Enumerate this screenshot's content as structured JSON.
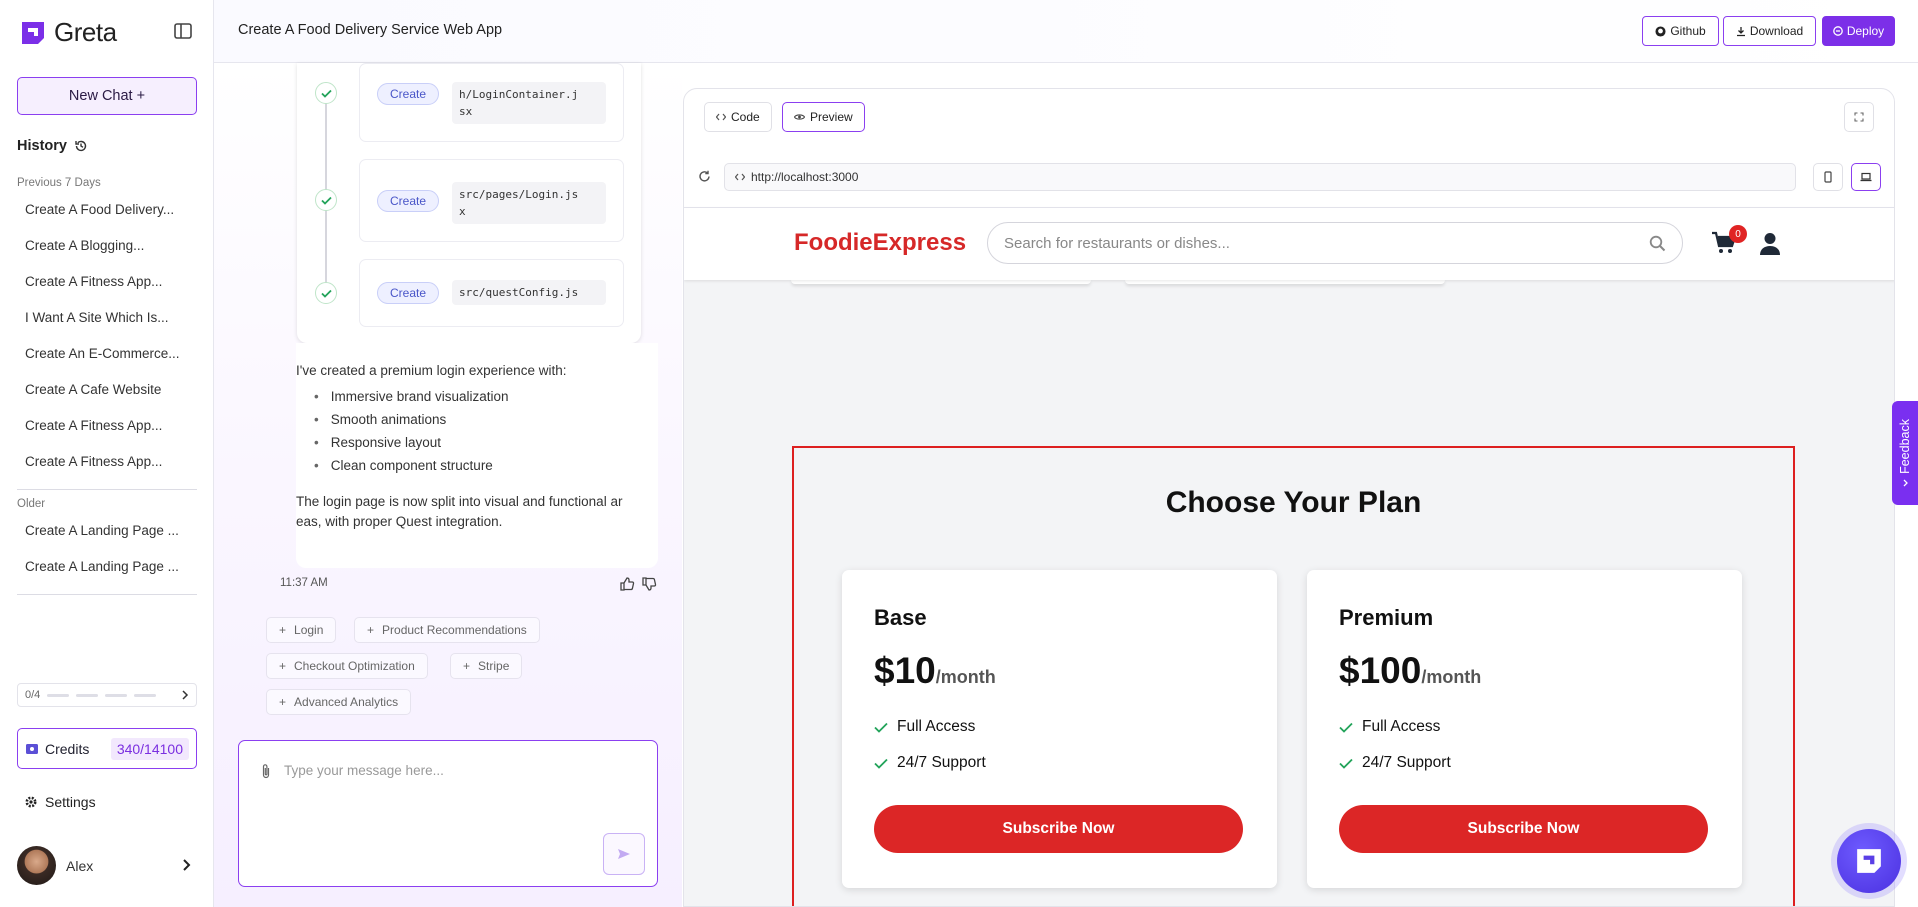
{
  "colors": {
    "accent": "#8b3ff0",
    "deploy": "#7c2fe8",
    "brand_red": "#d62828",
    "button_red": "#dc2626",
    "check_green": "#22a35a"
  },
  "sidebar": {
    "app_name": "Greta",
    "new_chat": "New Chat +",
    "history_title": "History",
    "group_recent": "Previous 7 Days",
    "recent_items": [
      "Create A Food Delivery...",
      "Create A Blogging...",
      "Create A Fitness App...",
      "I Want A Site Which Is...",
      "Create An E-Commerce...",
      "Create A Cafe Website",
      "Create A Fitness App...",
      "Create A Fitness App..."
    ],
    "group_older": "Older",
    "older_items": [
      "Create A Landing Page ...",
      "Create A Landing Page ..."
    ],
    "progress_label": "0/4",
    "credits_label": "Credits",
    "credits_value": "340/14100",
    "settings_label": "Settings",
    "user_name": "Alex"
  },
  "topbar": {
    "title": "Create A Food Delivery Service Web App",
    "github": "Github",
    "download": "Download",
    "deploy": "Deploy"
  },
  "chat": {
    "steps": [
      {
        "action": "Create",
        "file": "h/LoginContainer.j\nsx"
      },
      {
        "action": "Create",
        "file": "src/pages/Login.js\nx"
      },
      {
        "action": "Create",
        "file": "src/questConfig.js"
      }
    ],
    "intro": "I've created a premium login experience with:",
    "bullets": [
      "Immersive brand visualization",
      "Smooth animations",
      "Responsive layout",
      "Clean component structure"
    ],
    "summary": "The login page is now split into visual and functional ar\neas, with proper Quest integration.",
    "time": "11:37 AM",
    "suggestions": [
      "Login",
      "Product Recommendations",
      "Checkout Optimization",
      "Stripe",
      "Advanced Analytics"
    ],
    "input_placeholder": "Type your message here..."
  },
  "preview": {
    "code_tab": "Code",
    "preview_tab": "Preview",
    "url": "http://localhost:3000",
    "site": {
      "brand": "FoodieExpress",
      "search_placeholder": "Search for restaurants or dishes...",
      "cart_count": "0",
      "plans_title": "Choose Your Plan",
      "plans": [
        {
          "name": "Base",
          "price": "$10",
          "period": "/month",
          "features": [
            "Full Access",
            "24/7 Support"
          ],
          "cta": "Subscribe Now"
        },
        {
          "name": "Premium",
          "price": "$100",
          "period": "/month",
          "features": [
            "Full Access",
            "24/7 Support"
          ],
          "cta": "Subscribe Now"
        }
      ]
    }
  },
  "feedback_tab": "Feedback",
  "icons": [
    "logo-icon",
    "sidebar-toggle-icon",
    "history-icon",
    "chevron-right-icon",
    "ticket-icon",
    "gear-icon",
    "github-icon",
    "download-icon",
    "deploy-icon",
    "check-icon",
    "thumbs-up-icon",
    "thumbs-down-icon",
    "plus-icon",
    "paperclip-icon",
    "send-icon",
    "code-icon",
    "eye-icon",
    "expand-icon",
    "refresh-icon",
    "phone-icon",
    "laptop-icon",
    "search-icon",
    "cart-icon",
    "user-icon"
  ]
}
